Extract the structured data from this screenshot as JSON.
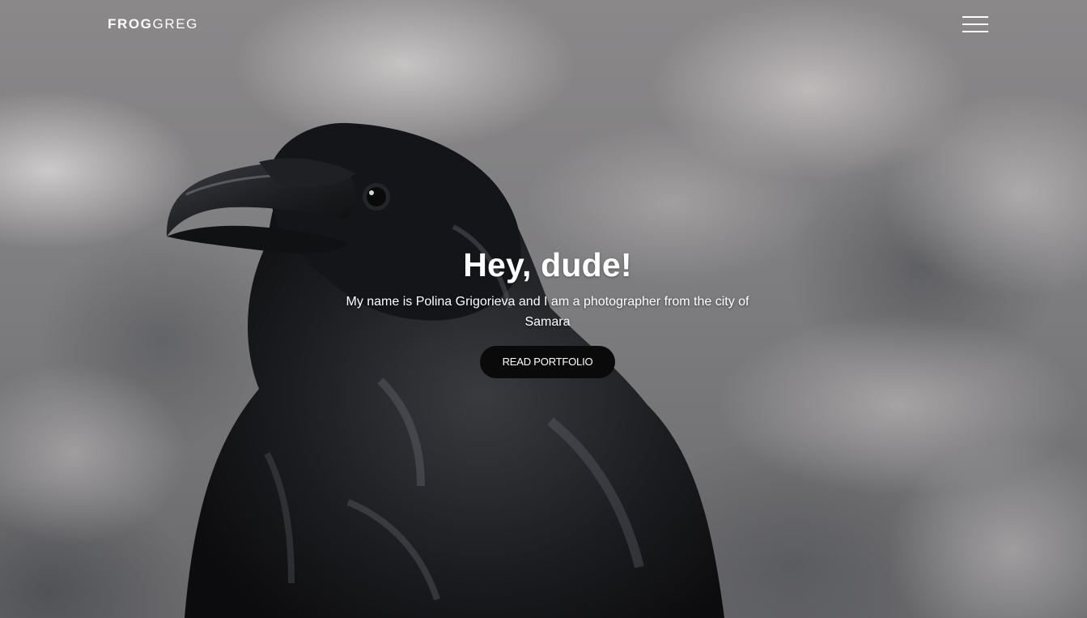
{
  "header": {
    "logo_bold": "FROG",
    "logo_light": "GREG",
    "menu_icon": "hamburger-menu-icon"
  },
  "hero": {
    "title": "Hey, dude!",
    "description": "My name is Polina Grigorieva and I am a photographer from the city of Samara",
    "button_label": "READ PORTFOLIO"
  },
  "colors": {
    "text": "#ffffff",
    "button_bg": "#0a0a0a"
  }
}
